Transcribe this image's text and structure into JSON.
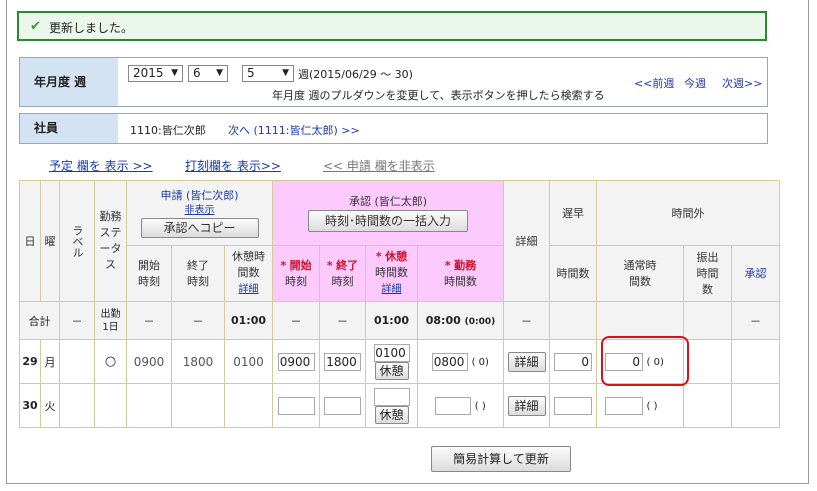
{
  "notice": {
    "text": "更新しました。"
  },
  "week": {
    "label": "年月度 週",
    "year": "2015",
    "month": "6",
    "week_no": "5",
    "range": "週(2015/06/29 ～ 30)",
    "hint": "年月度 週のプルダウンを変更して、表示ボタンを押したら検索する",
    "prev": "<<前週",
    "current": "今週",
    "next": "次週>>"
  },
  "employee": {
    "label": "社員",
    "value": "1110:皆仁次郎",
    "next_link": "次へ (1111:皆仁太郎) >>"
  },
  "toggles": {
    "plan": "予定 欄を 表示 >>",
    "stamp": "打刻欄を 表示>>",
    "apply": "<< 申請 欄を非表示"
  },
  "table": {
    "h_day": "日",
    "h_dow": "曜",
    "h_label": "ラベル",
    "h_status": "勤務ステータス",
    "h_apply": "申請 (皆仁次郎)",
    "h_hide": "非表示",
    "btn_copy": "承認へコピー",
    "h_approve": "承認 (皆仁太郎)",
    "btn_bulk": "時刻･時間数の一括入力",
    "h_detail": "詳細",
    "h_late": "遅早",
    "h_overtime": "時間外",
    "h_start_time": "開始時刻",
    "h_end_time": "終了時刻",
    "h_break_hours": "休憩時間数",
    "h_detail_link": "詳細",
    "h_a_start": "開始",
    "h_a_start2": "時刻",
    "h_a_end": "終了",
    "h_a_end2": "時刻",
    "h_a_break": "休憩",
    "h_a_break2": "時間数",
    "h_a_work": "勤務",
    "h_a_work2": "時間数",
    "h_hours": "時間数",
    "h_normal": "通常時間数",
    "h_transfer": "振出時間数",
    "h_ot_approve": "承認",
    "total": {
      "label": "合計",
      "dash": "－",
      "status": "出勤1日",
      "break": "01:00",
      "a_break": "01:00",
      "work": "08:00",
      "work_sub": "(0:00)"
    },
    "row29": {
      "day": "29",
      "dow": "月",
      "status": "○",
      "start": "0900",
      "end": "1800",
      "break": "0100",
      "a_start": "0900",
      "a_end": "1800",
      "a_break": "0100",
      "btn_break": "休憩",
      "a_work": "0800",
      "a_work_paren": "( 0)",
      "btn_detail": "詳細",
      "late": "0",
      "normal": "0",
      "normal_paren": "( 0)"
    },
    "row30": {
      "day": "30",
      "dow": "火",
      "btn_break": "休憩",
      "paren": "( )",
      "btn_detail": "詳細"
    }
  },
  "footer": {
    "btn": "簡易計算して更新"
  },
  "colors": {
    "accent_green": "#2b8a2b",
    "pink": "#fccafc",
    "label_blue": "#d3e3f3",
    "highlight_red": "#d8111c"
  }
}
